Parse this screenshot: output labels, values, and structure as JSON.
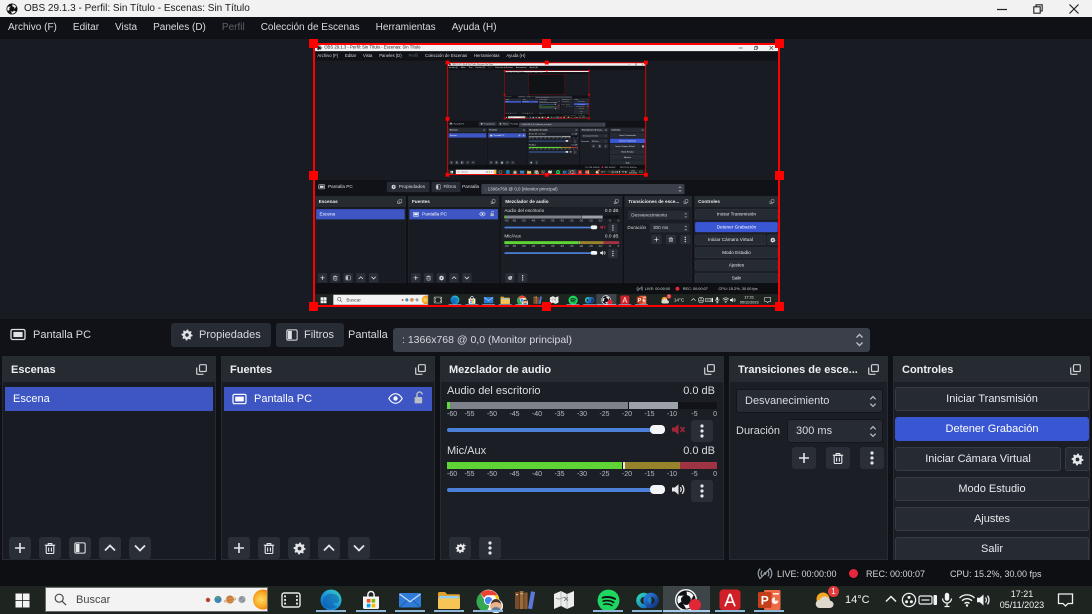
{
  "window": {
    "title": "OBS 29.1.3 - Perfil: Sin Título - Escenas: Sin Título",
    "minimize": "minimize",
    "restore": "restore",
    "close": "close"
  },
  "menu": {
    "items": [
      {
        "label": "Archivo (F)"
      },
      {
        "label": "Editar"
      },
      {
        "label": "Vista"
      },
      {
        "label": "Paneles (D)"
      },
      {
        "label": "Perfil"
      },
      {
        "label": "Colección de Escenas"
      },
      {
        "label": "Herramientas"
      },
      {
        "label": "Ayuda (H)"
      }
    ]
  },
  "source_toolbar": {
    "source_label": "Pantalla PC",
    "properties_label": "Propiedades",
    "filters_label": "Filtros",
    "screen_label": "Pantalla",
    "screen_value": ": 1366x768 @ 0,0 (Monitor principal)"
  },
  "docks": {
    "scenes": {
      "title": "Escenas",
      "items": [
        {
          "name": "Escena",
          "selected": true
        }
      ]
    },
    "sources": {
      "title": "Fuentes",
      "items": [
        {
          "name": "Pantalla PC",
          "selected": true,
          "visible": true,
          "locked": false
        }
      ]
    },
    "mixer": {
      "title": "Mezclador de audio",
      "ticks": [
        "-60",
        "-55",
        "-50",
        "-45",
        "-40",
        "-35",
        "-30",
        "-25",
        "-20",
        "-15",
        "-10",
        "-5",
        "0"
      ],
      "channels": [
        {
          "name": "Audio del escritorio",
          "db": "0.0 dB",
          "muted": true
        },
        {
          "name": "Mic/Aux",
          "db": "0.0 dB",
          "muted": false
        }
      ]
    },
    "transitions": {
      "title": "Transiciones de esce...",
      "transition": "Desvanecimiento",
      "duration_label": "Duración",
      "duration_value": "300 ms"
    },
    "controls": {
      "title": "Controles",
      "buttons": [
        {
          "label": "Iniciar Transmisión",
          "active": false
        },
        {
          "label": "Detener Grabación",
          "active": true
        },
        {
          "label": "Iniciar Cámara Virtual",
          "active": false,
          "has_config": true
        },
        {
          "label": "Modo Estudio",
          "active": false
        },
        {
          "label": "Ajustes",
          "active": false
        },
        {
          "label": "Salir",
          "active": false
        }
      ]
    }
  },
  "statusbar": {
    "live": "LIVE: 00:00:00",
    "rec": "REC: 00:00:07",
    "cpu": "CPU: 15.2%, 30.00 fps"
  },
  "taskbar": {
    "search_placeholder": "Buscar",
    "apps": [
      "start",
      "search",
      "task-view",
      "edge",
      "store",
      "mail",
      "explorer",
      "chrome",
      "books",
      "maps",
      "spotify",
      "webex",
      "obs",
      "acrobat",
      "powerpoint"
    ],
    "tray": {
      "weather_badge": "1",
      "weather_temp": "14°C",
      "icons": [
        "chevron-up",
        "obs-tray",
        "devices",
        "microphone",
        "wifi",
        "volume"
      ],
      "time": "17:21",
      "date": "05/11/2023"
    }
  },
  "colors": {
    "accent_blue": "#3e56c4",
    "record_red": "#e8273c",
    "selection_red": "#ff0000",
    "meter_green": "#61d836",
    "meter_yellow": "#d8b43a",
    "meter_red": "#c83c50",
    "slider_blue": "#4c80d8",
    "titlebar_bg": "#f2f2f2",
    "dock_bg": "#1b1e25",
    "taskbar_bg": "#1e2420"
  }
}
